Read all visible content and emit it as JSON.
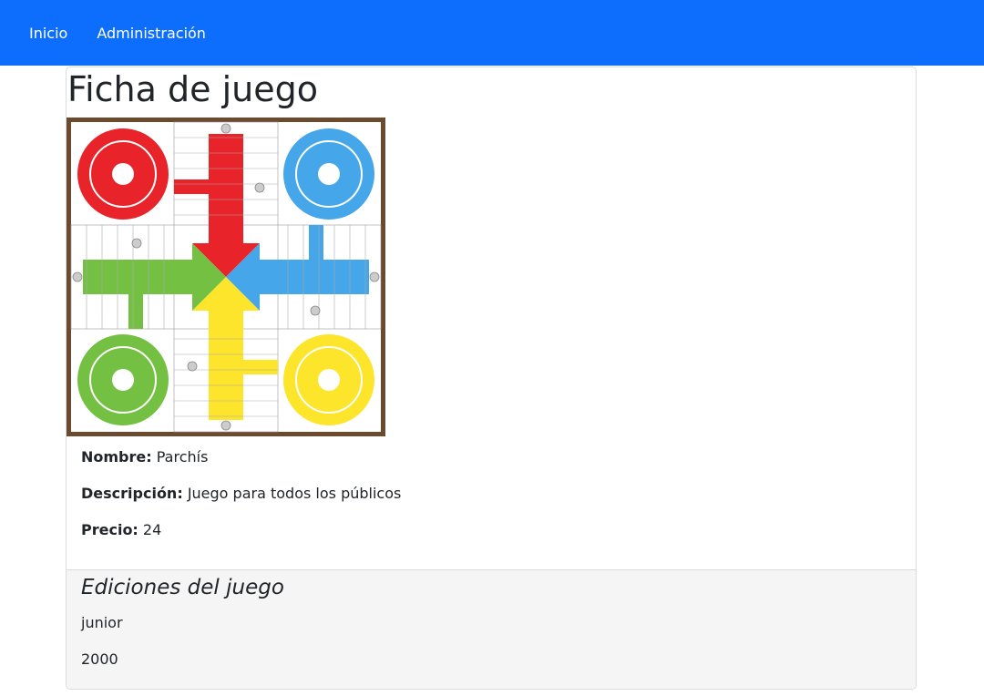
{
  "nav": {
    "items": [
      {
        "label": "Inicio"
      },
      {
        "label": "Administración"
      }
    ],
    "color": "#0d6efd"
  },
  "page": {
    "title": "Ficha de juego"
  },
  "game": {
    "name_label": "Nombre:",
    "name": "Parchís",
    "description_label": "Descripción:",
    "description": "Juego para todos los públicos",
    "price_label": "Precio:",
    "price": "24",
    "image_icon": "parchis-board-image"
  },
  "editions": {
    "heading": "Ediciones del juego",
    "items": [
      {
        "label": "junior"
      },
      {
        "label": "2000"
      }
    ]
  }
}
